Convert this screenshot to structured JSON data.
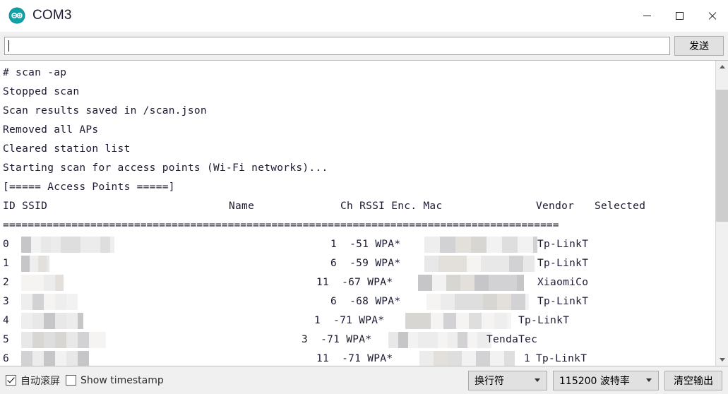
{
  "window": {
    "title": "COM3",
    "app_icon": "arduino-logo-icon",
    "icon_color": "#10a2a6",
    "minimize_label": "—",
    "maximize_label": "□",
    "close_label": "✕"
  },
  "send_row": {
    "input_value": "",
    "input_placeholder": "",
    "send_label": "发送"
  },
  "terminal": {
    "lines": [
      "# scan -ap",
      "Stopped scan",
      "Scan results saved in /scan.json",
      "Removed all APs",
      "Cleared station list",
      "Starting scan for access points (Wi-Fi networks)...",
      "[===== Access Points =====]"
    ],
    "header": {
      "id_ssid": "ID SSID",
      "name": "Name",
      "ch_rssi_enc_mac": "Ch RSSI Enc. Mac",
      "vendor": "Vendor",
      "selected": "Selected"
    },
    "divider": "=========================================================================================",
    "rows": [
      {
        "id": "0",
        "ch": "1",
        "rssi": "-51",
        "enc": "WPA*",
        "vendor": "Tp-LinkT",
        "selected": "",
        "ssid_redacted": true,
        "mac_redacted": true
      },
      {
        "id": "1",
        "ch": "6",
        "rssi": "-59",
        "enc": "WPA*",
        "vendor": "Tp-LinkT",
        "selected": "",
        "ssid_redacted": true,
        "mac_redacted": true
      },
      {
        "id": "2",
        "ch": "11",
        "rssi": "-67",
        "enc": "WPA*",
        "vendor": "XiaomiCo",
        "selected": "",
        "ssid_redacted": true,
        "mac_redacted": true
      },
      {
        "id": "3",
        "ch": "6",
        "rssi": "-68",
        "enc": "WPA*",
        "vendor": "Tp-LinkT",
        "selected": "",
        "ssid_redacted": true,
        "mac_redacted": true
      },
      {
        "id": "4",
        "ch": "1",
        "rssi": "-71",
        "enc": "WPA*",
        "vendor": "Tp-LinkT",
        "selected": "",
        "ssid_redacted": true,
        "mac_redacted": true
      },
      {
        "id": "5",
        "ch": "3",
        "rssi": "-71",
        "enc": "WPA*",
        "vendor": "TendaTec",
        "selected": "",
        "ssid_redacted": true,
        "mac_redacted": true
      },
      {
        "id": "6",
        "ch": "11",
        "rssi": "-71",
        "enc": "WPA*",
        "vendor": "Tp-LinkT",
        "selected": "1",
        "ssid_redacted": true,
        "mac_redacted": true
      }
    ]
  },
  "scrollbar": {
    "up_arrow": "scroll-up-icon",
    "down_arrow": "scroll-down-icon",
    "thumb_top_pct": 6,
    "thumb_height_pct": 47
  },
  "bottom_bar": {
    "autoscroll_label": "自动滚屏",
    "autoscroll_checked": true,
    "timestamp_label": "Show timestamp",
    "timestamp_checked": false,
    "line_ending": "换行符",
    "baud_rate": "115200 波特率",
    "clear_label": "清空输出"
  }
}
